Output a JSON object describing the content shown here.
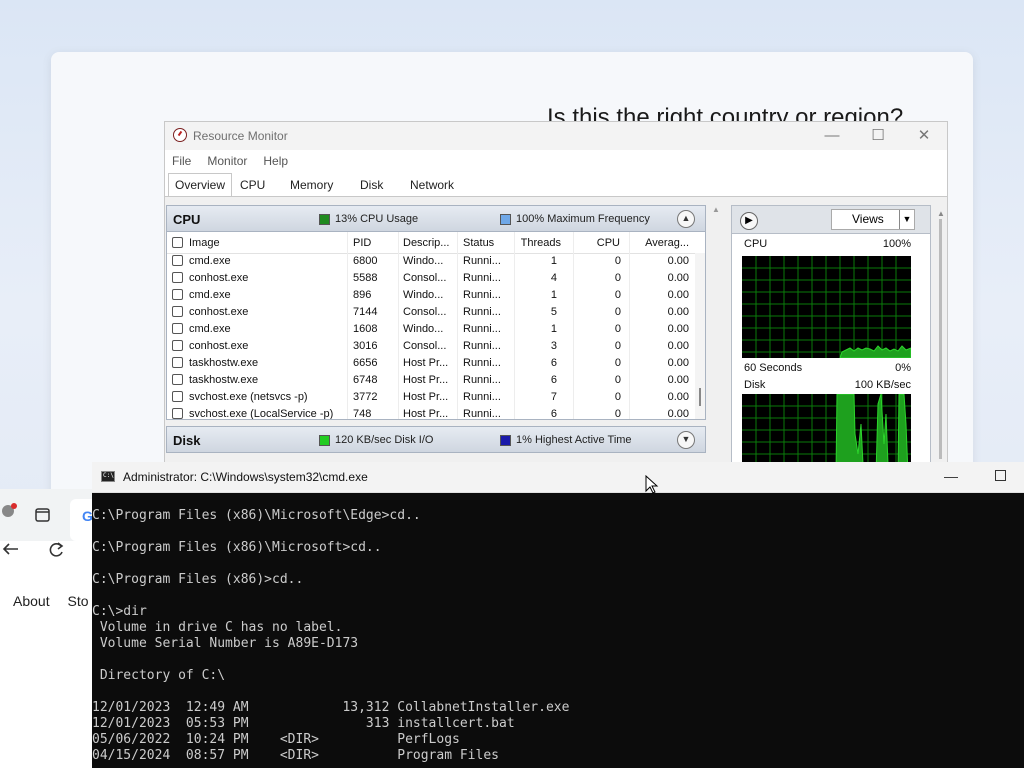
{
  "oobe": {
    "title": "Is this the right country or region?"
  },
  "resmon": {
    "title": "Resource Monitor",
    "menu": [
      "File",
      "Monitor",
      "Help"
    ],
    "tabs": [
      "Overview",
      "CPU",
      "Memory",
      "Disk",
      "Network"
    ],
    "cpu_section": {
      "name": "CPU",
      "usage": "13% CPU Usage",
      "frequency": "100% Maximum Frequency",
      "usage_color": "#1f8a1f",
      "frequency_color": "#6fa8e8",
      "columns": [
        "Image",
        "PID",
        "Descrip...",
        "Status",
        "Threads",
        "CPU",
        "Averag..."
      ],
      "rows": [
        [
          "cmd.exe",
          "6800",
          "Windo...",
          "Runni...",
          "1",
          "0",
          "0.00"
        ],
        [
          "conhost.exe",
          "5588",
          "Consol...",
          "Runni...",
          "4",
          "0",
          "0.00"
        ],
        [
          "cmd.exe",
          "896",
          "Windo...",
          "Runni...",
          "1",
          "0",
          "0.00"
        ],
        [
          "conhost.exe",
          "7144",
          "Consol...",
          "Runni...",
          "5",
          "0",
          "0.00"
        ],
        [
          "cmd.exe",
          "1608",
          "Windo...",
          "Runni...",
          "1",
          "0",
          "0.00"
        ],
        [
          "conhost.exe",
          "3016",
          "Consol...",
          "Runni...",
          "3",
          "0",
          "0.00"
        ],
        [
          "taskhostw.exe",
          "6656",
          "Host Pr...",
          "Runni...",
          "6",
          "0",
          "0.00"
        ],
        [
          "taskhostw.exe",
          "6748",
          "Host Pr...",
          "Runni...",
          "6",
          "0",
          "0.00"
        ],
        [
          "svchost.exe (netsvcs -p)",
          "3772",
          "Host Pr...",
          "Runni...",
          "7",
          "0",
          "0.00"
        ],
        [
          "svchost.exe (LocalService -p)",
          "748",
          "Host Pr...",
          "Runni...",
          "6",
          "0",
          "0.00"
        ]
      ]
    },
    "disk_section": {
      "name": "Disk",
      "io": "120 KB/sec Disk I/O",
      "active": "1% Highest Active Time",
      "io_color": "#22cc22",
      "active_color": "#1a1aaa"
    },
    "graphs": {
      "views_label": "Views",
      "cpu_label": "CPU",
      "cpu_max": "100%",
      "cpu_window": "60 Seconds",
      "cpu_min": "0%",
      "disk_label": "Disk",
      "disk_max": "100 KB/sec"
    }
  },
  "edge": {
    "links": [
      "About",
      "Sto"
    ]
  },
  "cmd": {
    "title": "Administrator: C:\\Windows\\system32\\cmd.exe",
    "lines": [
      "C:\\Program Files (x86)\\Microsoft\\Edge>cd..",
      "",
      "C:\\Program Files (x86)\\Microsoft>cd..",
      "",
      "C:\\Program Files (x86)>cd..",
      "",
      "C:\\>dir",
      " Volume in drive C has no label.",
      " Volume Serial Number is A89E-D173",
      "",
      " Directory of C:\\",
      "",
      "12/01/2023  12:49 AM            13,312 CollabnetInstaller.exe",
      "12/01/2023  05:53 PM               313 installcert.bat",
      "05/06/2022  10:24 PM    <DIR>          PerfLogs",
      "04/15/2024  08:57 PM    <DIR>          Program Files"
    ]
  }
}
